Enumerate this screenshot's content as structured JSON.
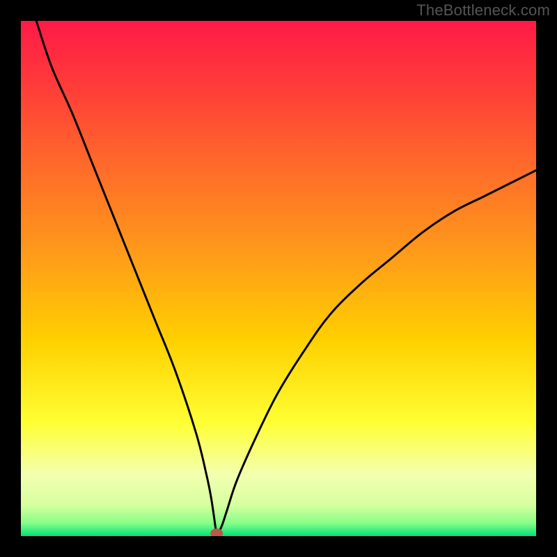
{
  "watermark": "TheBottleneck.com",
  "colors": {
    "frame": "#000000",
    "gradient_stops": [
      {
        "offset": 0.0,
        "color": "#ff1a47"
      },
      {
        "offset": 0.12,
        "color": "#ff3a3a"
      },
      {
        "offset": 0.28,
        "color": "#ff6a2a"
      },
      {
        "offset": 0.45,
        "color": "#ff9a1a"
      },
      {
        "offset": 0.62,
        "color": "#ffd000"
      },
      {
        "offset": 0.78,
        "color": "#ffff33"
      },
      {
        "offset": 0.88,
        "color": "#f4ffb0"
      },
      {
        "offset": 0.94,
        "color": "#d6ffa0"
      },
      {
        "offset": 0.975,
        "color": "#86ff86"
      },
      {
        "offset": 1.0,
        "color": "#00e07a"
      }
    ],
    "curve": "#000000",
    "marker": "#b85a4a"
  },
  "chart_data": {
    "type": "line",
    "title": "",
    "xlabel": "",
    "ylabel": "",
    "xlim": [
      0,
      100
    ],
    "ylim": [
      0,
      100
    ],
    "minimum_x": 38,
    "x": [
      3,
      6,
      10,
      14,
      18,
      22,
      26,
      30,
      34,
      36,
      37,
      38,
      39,
      40,
      42,
      46,
      50,
      55,
      60,
      66,
      72,
      78,
      84,
      90,
      96,
      100
    ],
    "values": [
      100,
      91,
      82,
      72,
      62,
      52,
      42,
      32,
      20,
      12,
      7,
      0,
      2,
      5,
      11,
      20,
      28,
      36,
      43,
      49,
      54,
      59,
      63,
      66,
      69,
      71
    ],
    "marker": {
      "x": 38,
      "y": 0
    }
  }
}
